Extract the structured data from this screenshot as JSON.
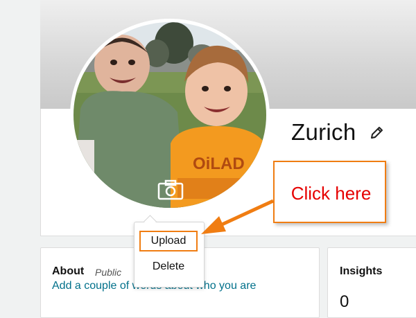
{
  "profile": {
    "name": "Zurich",
    "upload_menu": {
      "upload_label": "Upload",
      "delete_label": "Delete"
    }
  },
  "about": {
    "title": "About",
    "visibility": "Public",
    "prompt_link": "Add a couple of words about who you are"
  },
  "insights": {
    "title": "Insights",
    "count": "0"
  },
  "annotation": {
    "callout_text": "Click here",
    "highlight_color": "#f07d12",
    "text_color": "#e60000"
  },
  "icons": {
    "camera": "camera-icon",
    "edit": "pencil-icon"
  },
  "colors": {
    "link": "#00708a",
    "background": "#f0f2f2"
  }
}
